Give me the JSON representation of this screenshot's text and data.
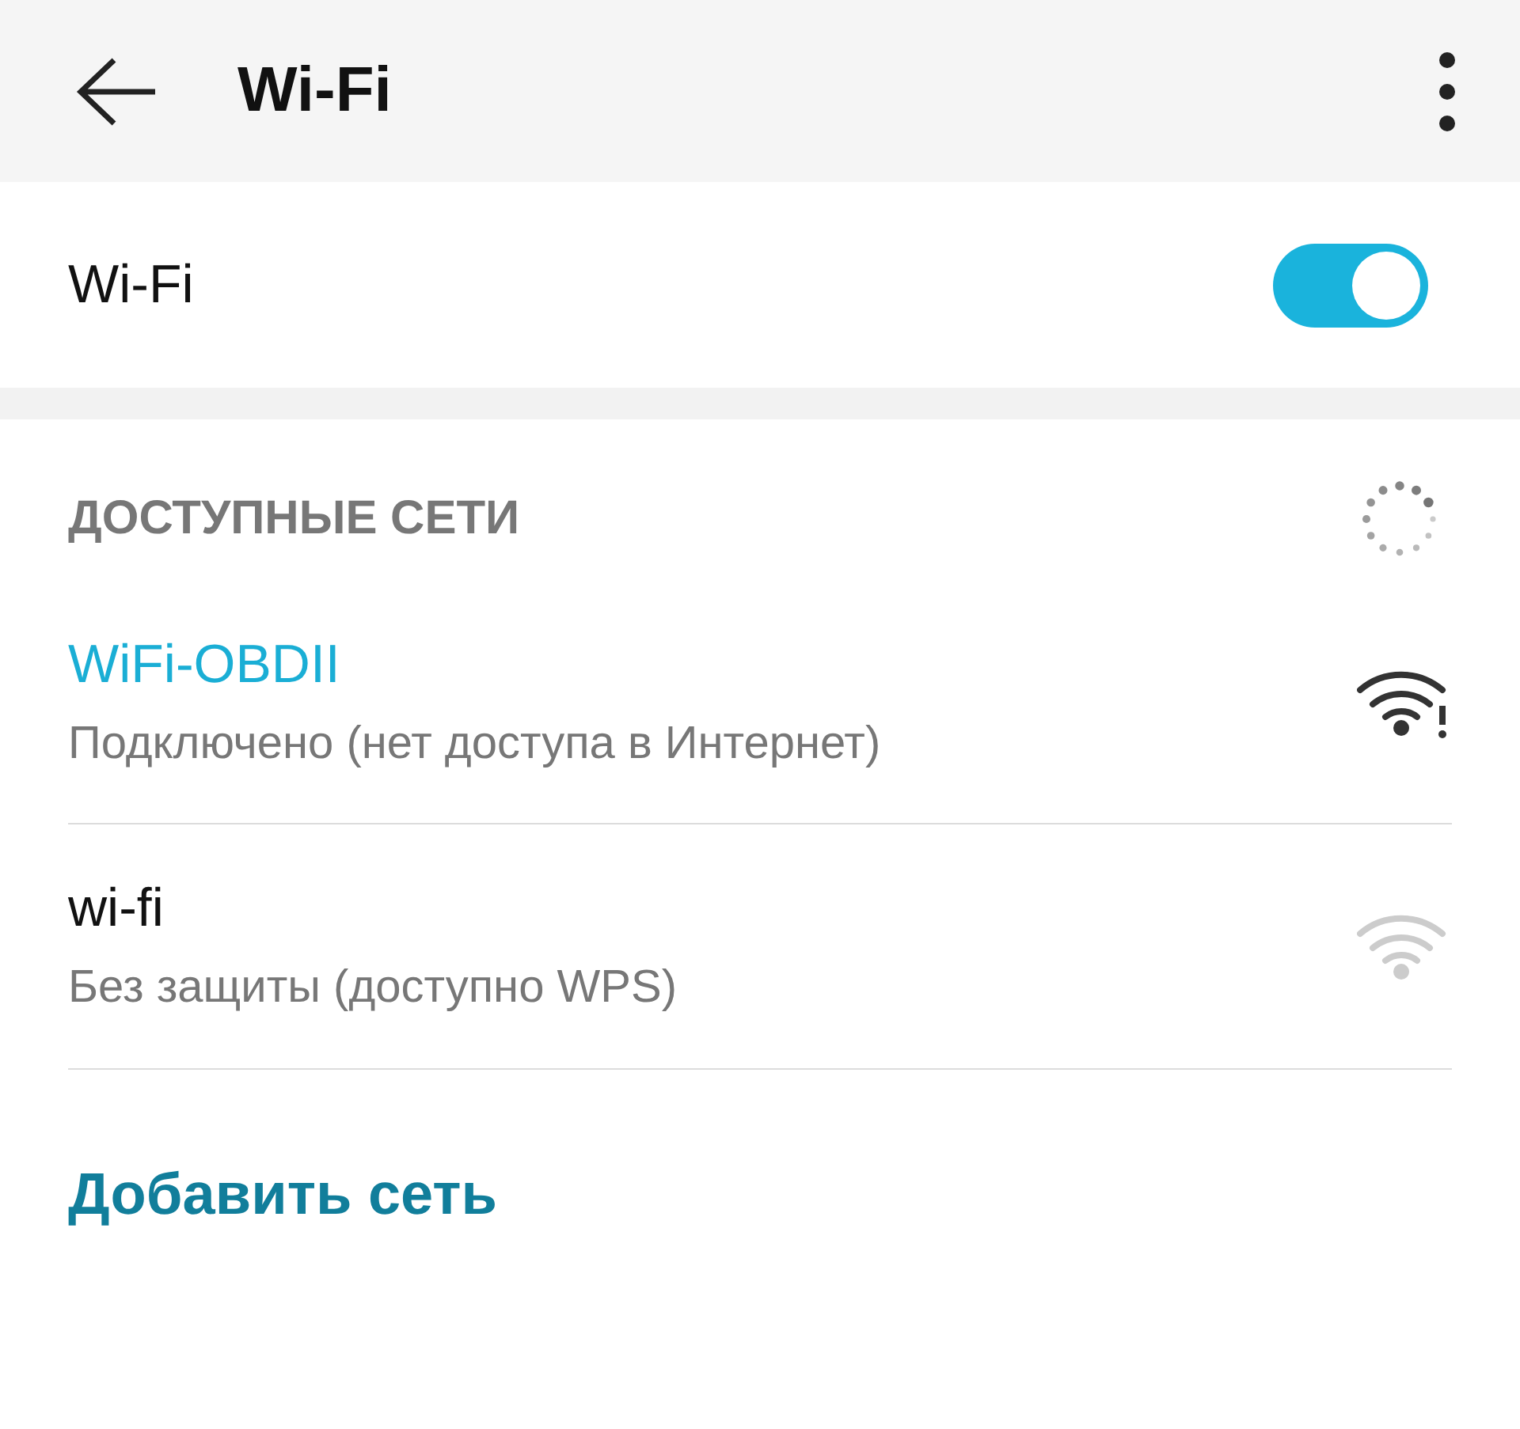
{
  "app_bar": {
    "title": "Wi-Fi"
  },
  "wifi_switch": {
    "label": "Wi-Fi",
    "on": true
  },
  "networks_section": {
    "header": "ДОСТУПНЫЕ СЕТИ",
    "scanning": true
  },
  "networks": [
    {
      "name": "WiFi-OBDII",
      "status": "Подключено (нет доступа в Интернет)",
      "connected": true,
      "no_internet": true
    },
    {
      "name": "wi-fi",
      "status": "Без защиты (доступно WPS)",
      "connected": false,
      "no_internet": false
    }
  ],
  "add_network": "Добавить сеть"
}
